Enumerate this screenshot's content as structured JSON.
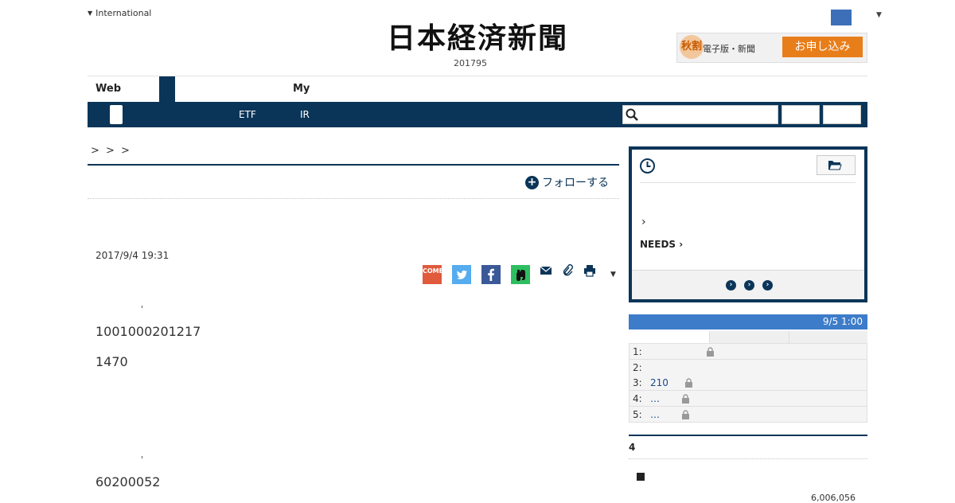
{
  "header": {
    "region_label": "International",
    "logo_text": "日本経済新聞",
    "edition_number": "201795",
    "promo": {
      "badge": "秋割",
      "text": "電子版・新聞",
      "cta": "お申し込み"
    }
  },
  "tabs": {
    "web": "Web",
    "my": "My"
  },
  "nav": {
    "etf": "ETF",
    "ir": "IR",
    "search_placeholder": "",
    "search_icon": "search-icon"
  },
  "article": {
    "breadcrumb": "> > >",
    "follow_label": "フォローする",
    "date": "2017/9/4 19:31",
    "paragraphs": [
      "1001000201217",
      "1470",
      "60200052"
    ],
    "share_icons": [
      "come-share-icon",
      "twitter-icon",
      "facebook-icon",
      "evernote-icon",
      "mail-icon",
      "clip-icon",
      "print-icon",
      "chevron-down-icon"
    ],
    "share_come": "COME"
  },
  "sidebar": {
    "history_icon": "clock-icon",
    "folder_icon": "folder-icon",
    "chevron": "›",
    "needs_label": "NEEDS ›",
    "ranking": {
      "updated": "9/5 1:00",
      "rows": [
        {
          "rank": "1:",
          "text": ""
        },
        {
          "rank": "2:",
          "text": ""
        },
        {
          "rank": "3:",
          "text": "210"
        },
        {
          "rank": "4:",
          "text": "…"
        },
        {
          "rank": "5:",
          "text": "…"
        }
      ]
    },
    "section_title": "4",
    "section_number": "6,006,056"
  },
  "colors": {
    "navy": "#0b3558",
    "accent_blue": "#3d7cc9",
    "cta_orange": "#e87e1a"
  }
}
